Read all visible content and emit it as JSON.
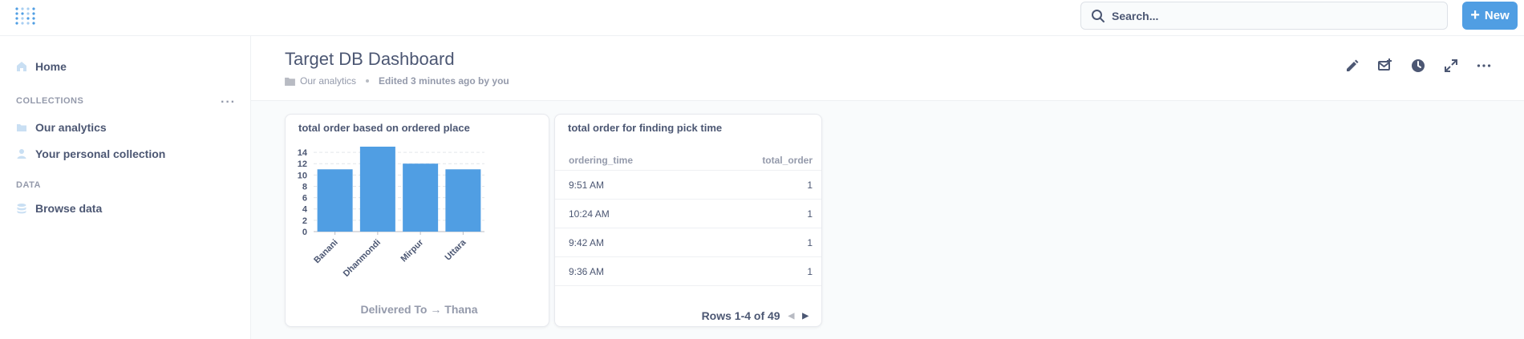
{
  "topbar": {
    "logo_icon": "metabase-logo-icon",
    "search_placeholder": "Search...",
    "new_button_label": "New",
    "accent_color": "#509ee3"
  },
  "sidebar": {
    "home_label": "Home",
    "collections_heading": "COLLECTIONS",
    "collections": [
      {
        "label": "Our analytics",
        "icon": "folder-icon"
      },
      {
        "label": "Your personal collection",
        "icon": "person-icon"
      }
    ],
    "data_heading": "DATA",
    "browse_label": "Browse data"
  },
  "dashboard": {
    "title": "Target DB Dashboard",
    "collection": "Our analytics",
    "edited": "Edited 3 minutes ago by you",
    "actions": [
      "edit-icon",
      "subscribe-icon",
      "history-icon",
      "fullscreen-icon",
      "more-icon"
    ]
  },
  "cards": {
    "bar": {
      "title": "total order based on ordered place",
      "axis_title": "Delivered To → Thana"
    },
    "table": {
      "title": "total order for finding pick time",
      "col1": "ordering_time",
      "col2": "total_order",
      "rows": [
        {
          "time": "9:51 AM",
          "count": "1"
        },
        {
          "time": "10:24 AM",
          "count": "1"
        },
        {
          "time": "9:42 AM",
          "count": "1"
        },
        {
          "time": "9:36 AM",
          "count": "1"
        }
      ],
      "pager": "Rows 1-4 of 49"
    }
  },
  "chart_data": {
    "type": "bar",
    "title": "total order based on ordered place",
    "categories": [
      "Banani",
      "Dhanmondi",
      "Mirpur",
      "Uttara"
    ],
    "values": [
      11,
      15,
      12,
      11
    ],
    "xlabel": "Delivered To → Thana",
    "ylabel": "",
    "ylim": [
      0,
      15
    ],
    "yticks": [
      0,
      2,
      4,
      6,
      8,
      10,
      12,
      14
    ],
    "grid": true,
    "color": "#509ee3"
  }
}
